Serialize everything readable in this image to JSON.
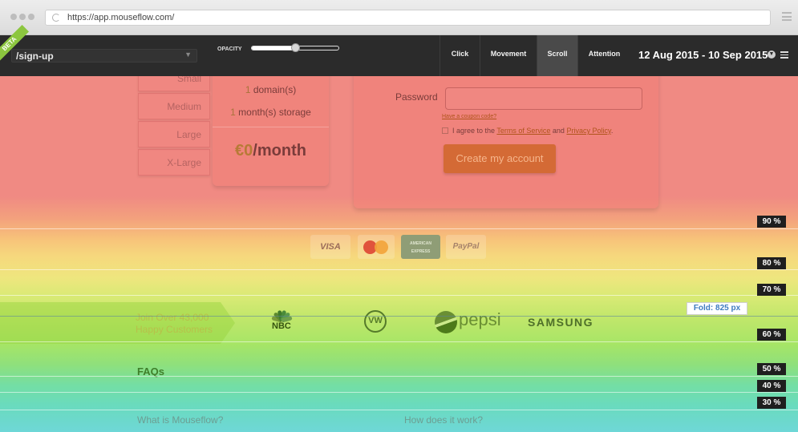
{
  "browser": {
    "url": "https://app.mouseflow.com/"
  },
  "toolbar": {
    "beta": "BETA",
    "page": "/sign-up",
    "opacity_label": "OPACITY",
    "opacity_level": 0.5,
    "tabs": [
      {
        "label": "Click",
        "active": false
      },
      {
        "label": "Movement",
        "active": false
      },
      {
        "label": "Scroll",
        "active": true
      },
      {
        "label": "Attention",
        "active": false
      }
    ],
    "date_range": "12 Aug 2015 - 10 Sep 2015"
  },
  "pricing": {
    "sizes": [
      "Small",
      "Medium",
      "Large",
      "X-Large"
    ],
    "domains_num": "1",
    "domains_text": " domain(s)",
    "storage_num": "1",
    "storage_text": " month(s) storage",
    "price_currency": "€0",
    "price_period": "/month"
  },
  "signup": {
    "password_label": "Password",
    "coupon_link": "Have a coupon code?",
    "agree_prefix": "I agree to the ",
    "terms_link": "Terms of Service",
    "agree_and": " and ",
    "privacy_link": "Privacy Policy",
    "agree_suffix": ".",
    "create_button": "Create my account"
  },
  "payments": {
    "visa": "VISA",
    "amex_line1": "AMERICAN",
    "amex_line2": "EXPRESS",
    "paypal": "PayPal"
  },
  "customers": {
    "join_line1": "Join Over 43,000",
    "join_line2": "Happy Customers",
    "nbc": "NBC",
    "vw": "VW",
    "pepsi": "pepsi",
    "samsung": "SAMSUNG"
  },
  "faq": {
    "title": "FAQs",
    "q1": "What is Mouseflow?",
    "q2": "How does it work?"
  },
  "scroll_markers": [
    "90 %",
    "80 %",
    "70 %",
    "60 %",
    "50 %",
    "40 %",
    "30 %"
  ],
  "fold": "Fold: 825 px",
  "colors": {
    "toolbar_bg": "#2b2b2b",
    "beta_green": "#8cc63f",
    "heat_red": "#f08a83",
    "heat_yellow": "#eee67e",
    "heat_green": "#a6e566",
    "heat_cyan": "#6ed7d7",
    "fold_blue": "#3e7bc0"
  }
}
